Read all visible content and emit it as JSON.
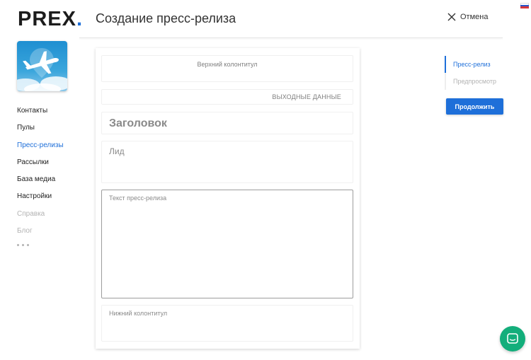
{
  "brand": {
    "name": "PREX",
    "dot": ".",
    "accent": "#1e6fd9"
  },
  "header": {
    "title": "Создание пресс-релиза",
    "cancel_label": "Отмена",
    "locale_flag": "ru-flag-icon"
  },
  "sidebar": {
    "avatar_icon": "airplane-icon",
    "items": [
      {
        "label": "Контакты",
        "state": "normal"
      },
      {
        "label": "Пулы",
        "state": "normal"
      },
      {
        "label": "Пресс-релизы",
        "state": "active"
      },
      {
        "label": "Рассылки",
        "state": "normal"
      },
      {
        "label": "База медиа",
        "state": "normal"
      },
      {
        "label": "Настройки",
        "state": "normal"
      },
      {
        "label": "Справка",
        "state": "muted"
      },
      {
        "label": "Блог",
        "state": "muted"
      }
    ],
    "more_icon": "more-dots-icon"
  },
  "editor": {
    "header_placeholder": "Верхний колонтитул",
    "output_data_label": "ВЫХОДНЫЕ ДАННЫЕ",
    "title_placeholder": "Заголовок",
    "lead_placeholder": "Лид",
    "body_placeholder": "Текст пресс-релиза",
    "footer_placeholder": "Нижний колонтитул"
  },
  "steps": {
    "items": [
      {
        "label": "Пресс-релиз",
        "active": true
      },
      {
        "label": "Предпросмотр",
        "active": false
      }
    ],
    "continue_label": "Продолжить"
  },
  "chat": {
    "icon": "chat-icon",
    "color": "#13ae7b"
  }
}
